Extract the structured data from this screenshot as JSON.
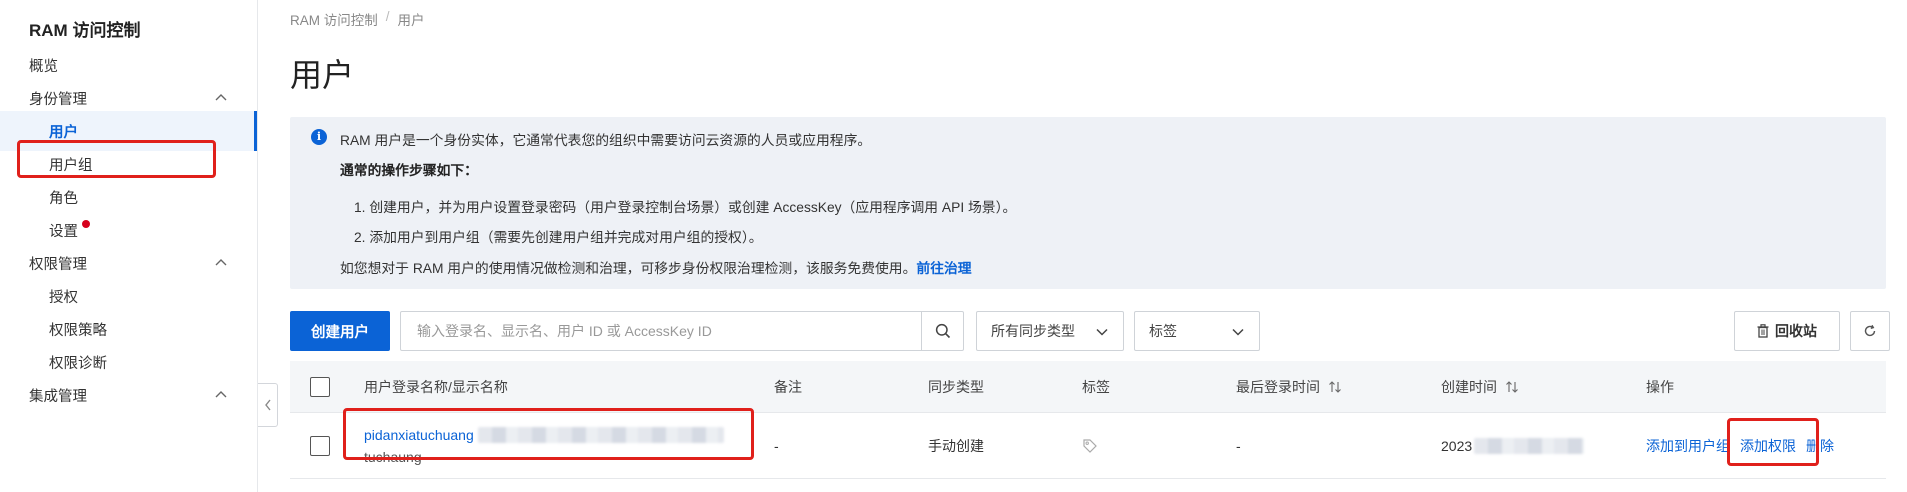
{
  "sidebar": {
    "title": "RAM 访问控制",
    "items": [
      {
        "label": "概览"
      },
      {
        "label": "身份管理"
      },
      {
        "label": "用户"
      },
      {
        "label": "用户组"
      },
      {
        "label": "角色"
      },
      {
        "label": "设置"
      },
      {
        "label": "权限管理"
      },
      {
        "label": "授权"
      },
      {
        "label": "权限策略"
      },
      {
        "label": "权限诊断"
      },
      {
        "label": "集成管理"
      }
    ]
  },
  "breadcrumb": [
    "RAM 访问控制",
    "/",
    "用户"
  ],
  "page_title": "用户",
  "info": {
    "line1": "RAM 用户是一个身份实体，它通常代表您的组织中需要访问云资源的人员或应用程序。",
    "line2": "通常的操作步骤如下：",
    "step1": "1. 创建用户，并为用户设置登录密码（用户登录控制台场景）或创建 AccessKey（应用程序调用 API 场景）。",
    "step2": "2. 添加用户到用户组（需要先创建用户组并完成对用户组的授权）。",
    "line5": "如您想对于 RAM 用户的使用情况做检测和治理，可移步身份权限治理检测，该服务免费使用。",
    "link": "前往治理"
  },
  "toolbar": {
    "create_label": "创建用户",
    "search_placeholder": "输入登录名、显示名、用户 ID 或 AccessKey ID",
    "sync_select": "所有同步类型",
    "tag_select": "标签",
    "recycle_label": "回收站"
  },
  "table": {
    "headers": {
      "name": "用户登录名称/显示名称",
      "note": "备注",
      "sync": "同步类型",
      "tag": "标签",
      "last_login": "最后登录时间",
      "created": "创建时间",
      "actions": "操作"
    },
    "rows": [
      {
        "login_name": "pidanxiatuchuang",
        "display_name": "tuchaung",
        "note": "-",
        "sync": "手动创建",
        "last_login": "-",
        "created": "2023",
        "actions": {
          "add_group": "添加到用户组",
          "add_perm": "添加权限",
          "delete": "删除"
        }
      }
    ]
  },
  "colors": {
    "accent": "#0b63d6",
    "highlight": "#e0201b",
    "notice": "#d6001c"
  }
}
